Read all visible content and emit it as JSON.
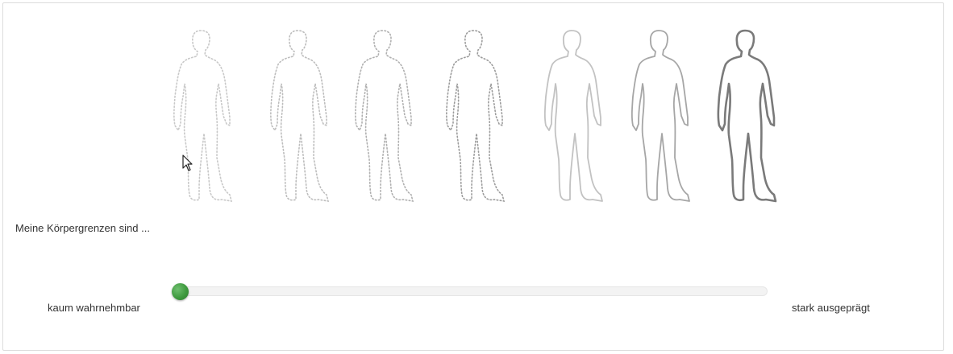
{
  "question": "Meine Körpergrenzen sind ...",
  "scale": {
    "min_label": "kaum wahrnehmbar",
    "max_label": "stark ausgeprägt",
    "value": 0,
    "steps": 7,
    "knob_color": "#3f9a3f"
  },
  "figures": [
    {
      "style": "dotted",
      "color": "#c8c8c8"
    },
    {
      "style": "dotted",
      "color": "#bdbdbd"
    },
    {
      "style": "dotted",
      "color": "#b0b0b0"
    },
    {
      "style": "dotted",
      "color": "#9c9c9c"
    },
    {
      "style": "solid",
      "color": "#c2c2c2"
    },
    {
      "style": "solid",
      "color": "#a6a6a6"
    },
    {
      "style": "solid",
      "color": "#7a7a7a"
    }
  ]
}
